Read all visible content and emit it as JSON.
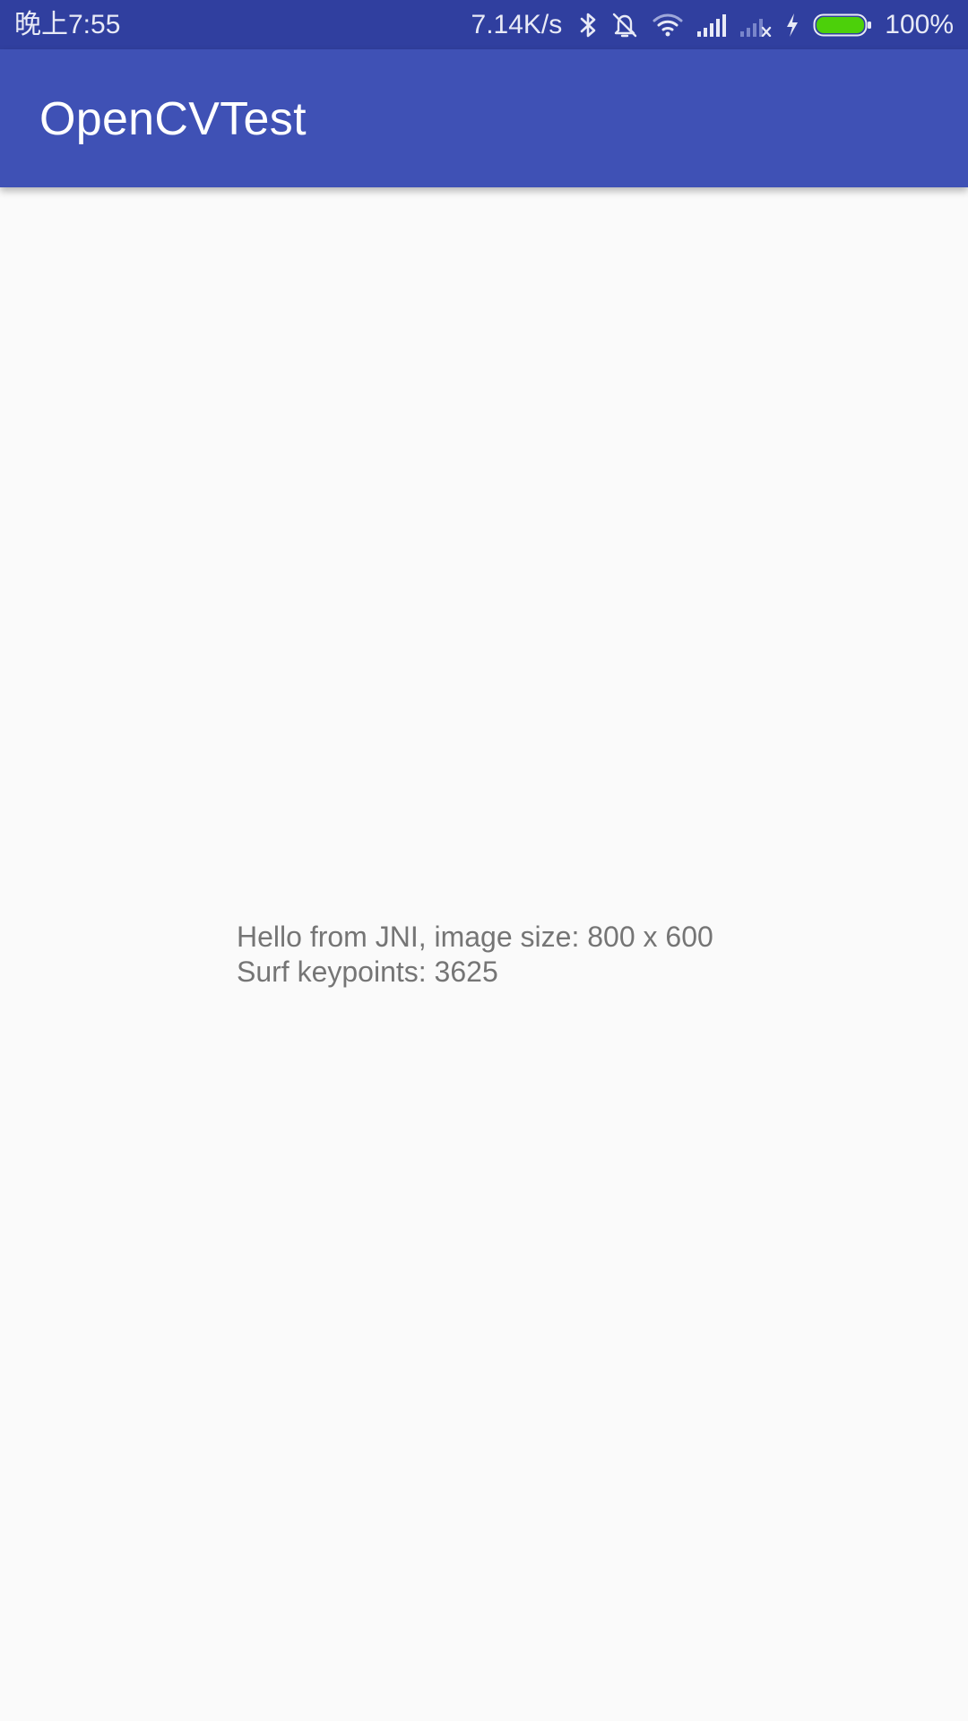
{
  "status_bar": {
    "time": "晚上7:55",
    "net_speed": "7.14K/s",
    "battery_percent": "100%",
    "icons": [
      "bluetooth-icon",
      "alarm-off-icon",
      "wifi-icon",
      "signal-icon",
      "signal-no-sim-icon",
      "charging-icon",
      "battery-icon"
    ],
    "battery_level": 1.0,
    "battery_color": "#4cd00a"
  },
  "app_bar": {
    "title": "OpenCVTest",
    "color": "#3f51b5"
  },
  "content": {
    "message_line1": "Hello from JNI, image size: 800 x 600",
    "message_line2": "Surf keypoints: 3625"
  }
}
